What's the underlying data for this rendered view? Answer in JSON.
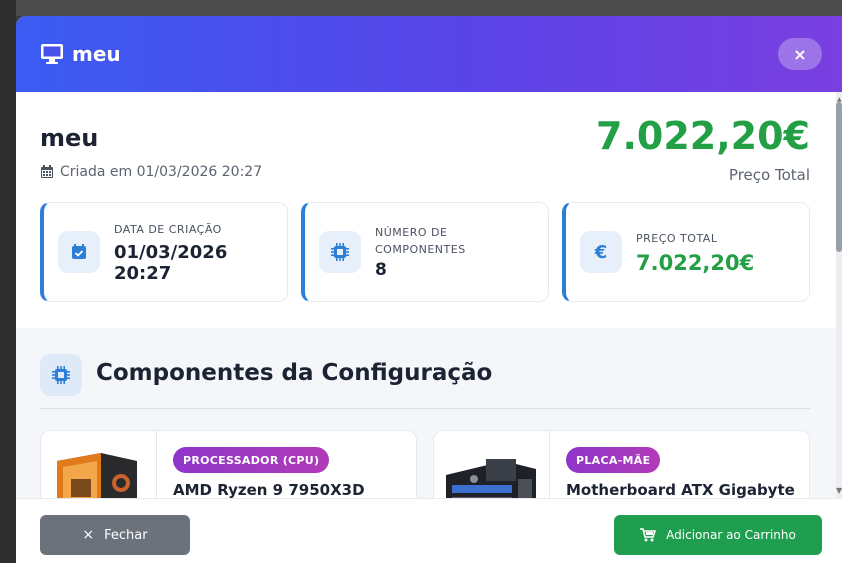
{
  "modal": {
    "title": "meu",
    "close_label": "×"
  },
  "config": {
    "name": "meu",
    "created_text": "Criada em 01/03/2026 20:27",
    "total_price": "7.022,20€",
    "total_price_label": "Preço Total"
  },
  "stats": [
    {
      "label": "DATA DE CRIAÇÃO",
      "value": "01/03/2026 20:27",
      "icon": "calendar-check-icon"
    },
    {
      "label_line1": "NÚMERO DE",
      "label_line2": "COMPONENTES",
      "value": "8",
      "icon": "chip-icon"
    },
    {
      "label": "PREÇO TOTAL",
      "value": "7.022,20€",
      "icon": "euro-icon",
      "icon_glyph": "€"
    }
  ],
  "components_section": {
    "title": "Componentes da Configuração",
    "items": [
      {
        "badge": "PROCESSADOR (CPU)",
        "name": "AMD Ryzen 9 7950X3D"
      },
      {
        "badge": "PLACA-MÃE",
        "name": "Motherboard ATX Gigabyte"
      }
    ]
  },
  "footer": {
    "close_label": "Fechar",
    "close_icon": "×",
    "cart_label": "Adicionar ao Carrinho"
  },
  "colors": {
    "header_gradient_start": "#3a5cf2",
    "header_gradient_end": "#7a3fe0",
    "price_green": "#23a045",
    "accent_blue": "#2c7fd6",
    "badge_purple": "#8e35c9",
    "cart_green": "#1f9e4f",
    "close_gray": "#6c727b"
  }
}
